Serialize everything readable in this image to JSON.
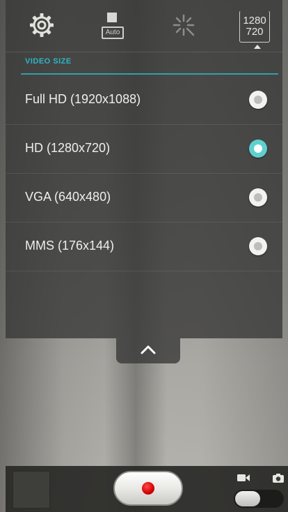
{
  "topbar": {
    "settings_icon": "gear-icon",
    "scene_label": "Auto",
    "effects_icon": "sparkle-icon",
    "size_top": "1280",
    "size_bottom": "720"
  },
  "section": {
    "title": "VIDEO SIZE",
    "accent_color": "#2fb6c8"
  },
  "options": [
    {
      "label": "Full HD (1920x1088)",
      "selected": false
    },
    {
      "label": "HD (1280x720)",
      "selected": true
    },
    {
      "label": "VGA (640x480)",
      "selected": false
    },
    {
      "label": "MMS (176x144)",
      "selected": false
    }
  ],
  "controls": {
    "collapse_icon": "chevron-up-icon",
    "record_icon": "record-icon",
    "video_mode_icon": "video-camera-icon",
    "photo_mode_icon": "camera-icon"
  }
}
